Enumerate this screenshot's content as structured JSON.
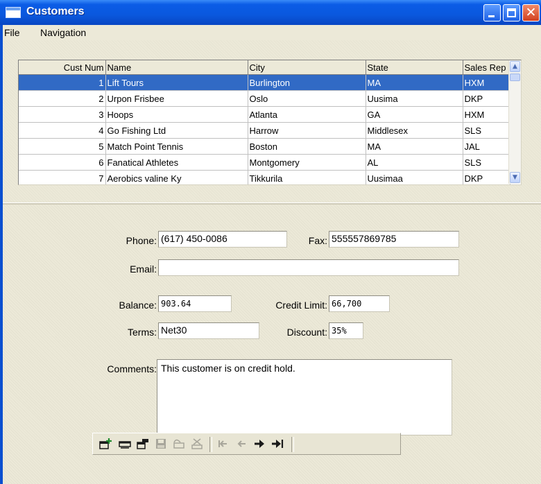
{
  "window": {
    "title": "Customers"
  },
  "menu": {
    "items": [
      "File",
      "Navigation"
    ]
  },
  "grid": {
    "columns": [
      "Cust Num",
      "Name",
      "City",
      "State",
      "Sales Rep"
    ],
    "rows": [
      {
        "num": "1",
        "name": "Lift Tours",
        "city": "Burlington",
        "state": "MA",
        "rep": "HXM"
      },
      {
        "num": "2",
        "name": "Urpon Frisbee",
        "city": "Oslo",
        "state": "Uusima",
        "rep": "DKP"
      },
      {
        "num": "3",
        "name": "Hoops",
        "city": "Atlanta",
        "state": "GA",
        "rep": "HXM"
      },
      {
        "num": "4",
        "name": "Go Fishing Ltd",
        "city": "Harrow",
        "state": "Middlesex",
        "rep": "SLS"
      },
      {
        "num": "5",
        "name": "Match Point Tennis",
        "city": "Boston",
        "state": "MA",
        "rep": "JAL"
      },
      {
        "num": "6",
        "name": "Fanatical Athletes",
        "city": "Montgomery",
        "state": "AL",
        "rep": "SLS"
      },
      {
        "num": "7",
        "name": "Aerobics valine Ky",
        "city": "Tikkurila",
        "state": "Uusimaa",
        "rep": "DKP"
      }
    ],
    "selected_row": 1
  },
  "form": {
    "phone": {
      "label": "Phone:",
      "value": "(617) 450-0086"
    },
    "fax": {
      "label": "Fax:",
      "value": "555557869785"
    },
    "email": {
      "label": "Email:",
      "value": ""
    },
    "balance": {
      "label": "Balance:",
      "value": "903.64"
    },
    "credit_limit": {
      "label": "Credit Limit:",
      "value": "66,700"
    },
    "terms": {
      "label": "Terms:",
      "value": "Net30"
    },
    "discount": {
      "label": "Discount:",
      "value": "35%"
    },
    "comments": {
      "label": "Comments:",
      "value": "This customer is on credit hold."
    }
  },
  "toolbar": {
    "icons": [
      "add-record-icon",
      "update-record-icon",
      "copy-record-icon",
      "save-record-icon",
      "undo-icon",
      "delete-record-icon",
      "first-record-icon",
      "previous-record-icon",
      "next-record-icon",
      "last-record-icon"
    ],
    "colors": {
      "enabled": "#1a1a1a",
      "accent": "#1f8a2c",
      "disabled": "#a8a69b"
    }
  }
}
